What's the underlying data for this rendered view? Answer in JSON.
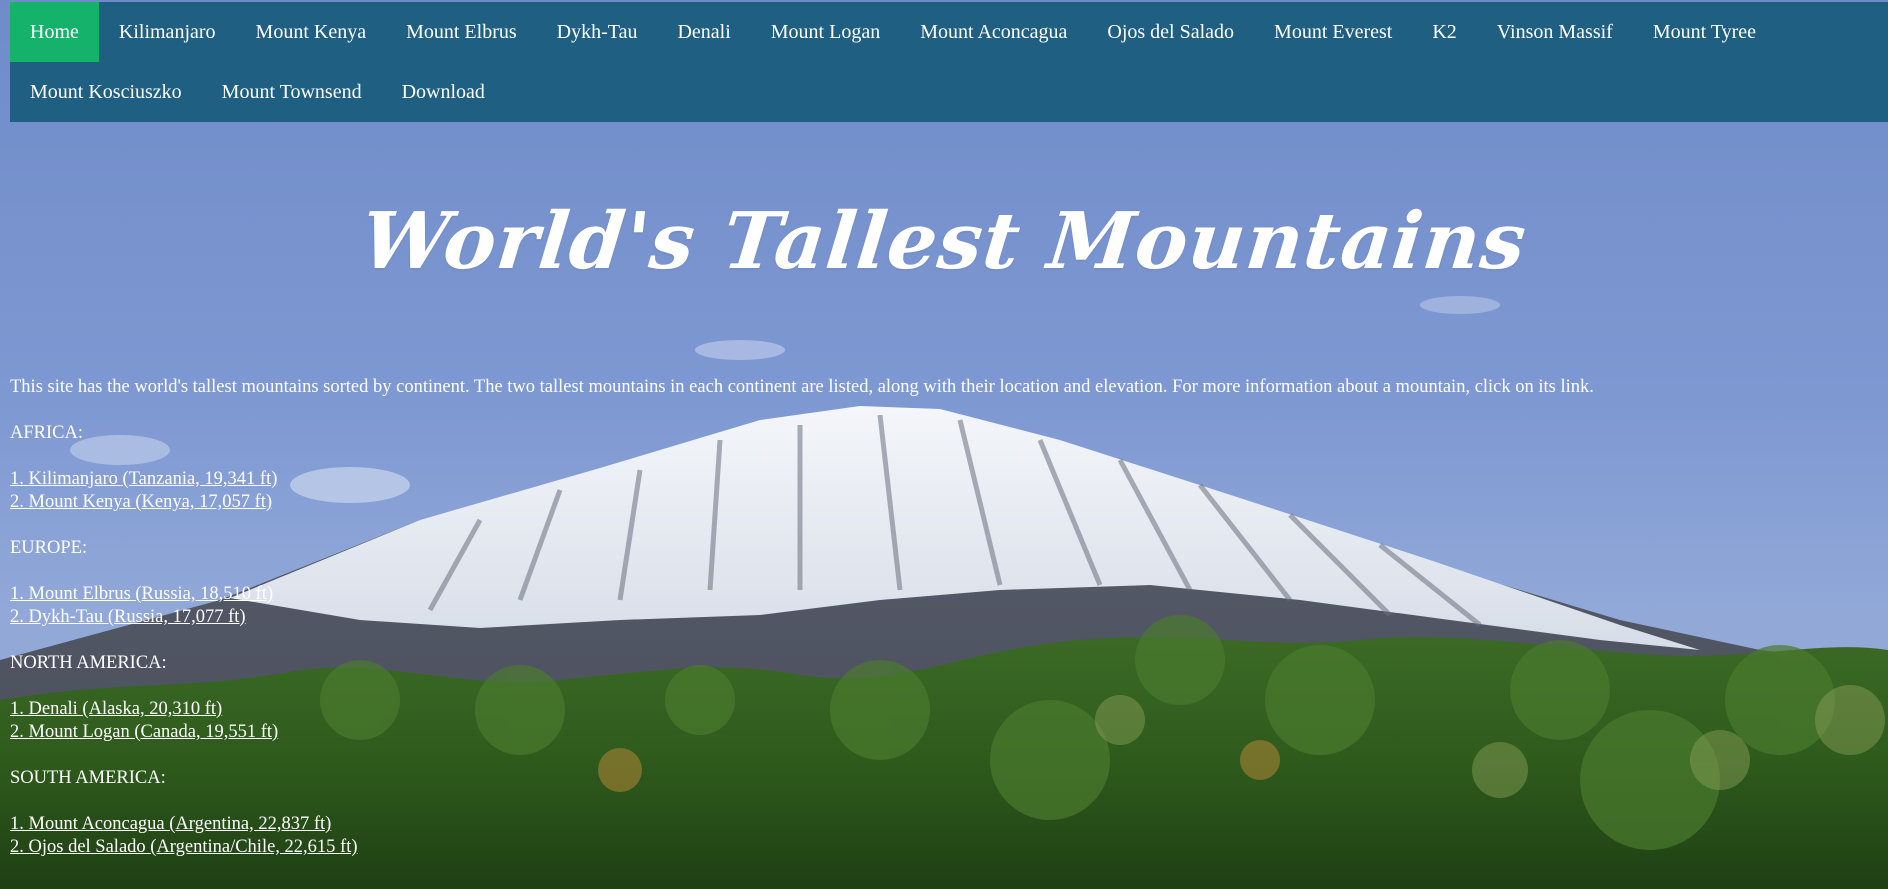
{
  "nav": {
    "row1": [
      {
        "label": "Home",
        "active": true
      },
      {
        "label": "Kilimanjaro"
      },
      {
        "label": "Mount Kenya"
      },
      {
        "label": "Mount Elbrus"
      },
      {
        "label": "Dykh-Tau"
      },
      {
        "label": "Denali"
      },
      {
        "label": "Mount Logan"
      },
      {
        "label": "Mount Aconcagua"
      },
      {
        "label": "Ojos del Salado"
      },
      {
        "label": "Mount Everest"
      },
      {
        "label": "K2"
      },
      {
        "label": "Vinson Massif"
      },
      {
        "label": "Mount Tyree"
      }
    ],
    "row2": [
      {
        "label": "Mount Kosciuszko"
      },
      {
        "label": "Mount Townsend"
      },
      {
        "label": "Download"
      }
    ]
  },
  "header": {
    "title": "World's Tallest Mountains"
  },
  "content": {
    "intro": "This site has the world's tallest mountains sorted by continent. The two tallest mountains in each continent are listed, along with their location and elevation. For more information about a mountain, click on its link.",
    "continents": [
      {
        "heading": "AFRICA:",
        "links": [
          "1. Kilimanjaro (Tanzania, 19,341 ft)",
          "2. Mount Kenya (Kenya, 17,057 ft)"
        ]
      },
      {
        "heading": "EUROPE:",
        "links": [
          "1. Mount Elbrus (Russia, 18,510 ft)",
          "2. Dykh-Tau (Russia, 17,077 ft)"
        ]
      },
      {
        "heading": "NORTH AMERICA:",
        "links": [
          "1. Denali (Alaska, 20,310 ft)",
          "2. Mount Logan (Canada, 19,551 ft)"
        ]
      },
      {
        "heading": "SOUTH AMERICA:",
        "links": [
          "1. Mount Aconcagua (Argentina, 22,837 ft)",
          "2. Ojos del Salado (Argentina/Chile, 22,615 ft)"
        ]
      }
    ]
  },
  "colors": {
    "nav_background": "#1f5f82",
    "nav_active": "#14b26b",
    "text": "#ffffff",
    "sky": "#7a93cf"
  },
  "background": {
    "icon": "mountain-photo"
  }
}
